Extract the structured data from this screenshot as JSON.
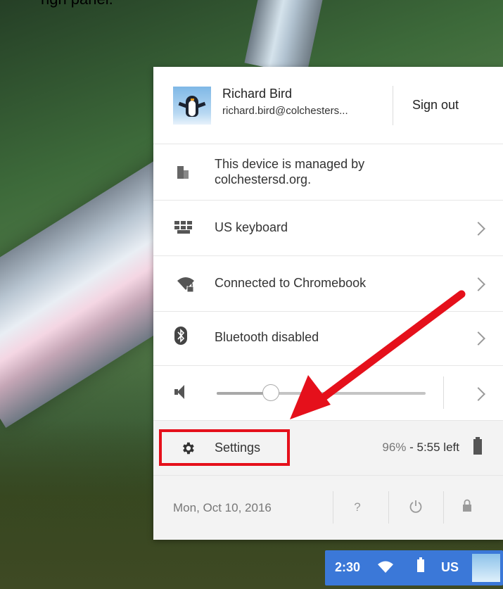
{
  "caption": "righ panel.",
  "user": {
    "name": "Richard Bird",
    "email": "richard.bird@colchesters...",
    "sign_out": "Sign out"
  },
  "managed": {
    "text": "This device is managed by colchestersd.org."
  },
  "keyboard": {
    "label": "US keyboard"
  },
  "network": {
    "label": "Connected to Chromebook"
  },
  "bluetooth": {
    "label": "Bluetooth disabled"
  },
  "volume": {
    "level": 0.26
  },
  "settings": {
    "label": "Settings",
    "battery_percent": "96%",
    "battery_sep": " - ",
    "battery_time": "5:55 left"
  },
  "footer": {
    "date": "Mon, Oct 10, 2016",
    "help_label": "?"
  },
  "tray": {
    "time": "2:30",
    "language": "US"
  },
  "colors": {
    "highlight": "#e5101b",
    "arrow": "#e5101b",
    "tray": "#3b78d8"
  }
}
